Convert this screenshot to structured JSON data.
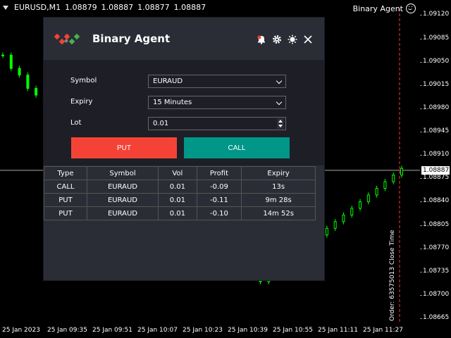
{
  "topbar": {
    "symbol": "EURUSD,M1",
    "prices": [
      "1.08879",
      "1.08887",
      "1.08877",
      "1.08887"
    ],
    "ea_name": "Binary Agent"
  },
  "chart_data": {
    "type": "line",
    "title": "",
    "xlabel": "",
    "ylabel": "",
    "x": [
      "25 Jan 2023",
      "25 Jan 09:35",
      "25 Jan 09:51",
      "25 Jan 10:07",
      "25 Jan 10:23",
      "25 Jan 10:39",
      "25 Jan 10:55",
      "25 Jan 11:11",
      "25 Jan 11:27"
    ],
    "ylim": [
      1.08665,
      1.0913
    ],
    "price_ticks": [
      "1.09120",
      "1.09085",
      "1.09050",
      "1.09015",
      "1.08980",
      "1.08945",
      "1.08910",
      "1.08875",
      "1.08840",
      "1.08805",
      "1.08770",
      "1.08735",
      "1.08700",
      "1.08665"
    ],
    "current_price": "1.08887",
    "current_price_value": 1.08887,
    "close_marker_label": "Order: 63575013 Close Time",
    "series": [
      {
        "values": [
          1.0906,
          1.0904,
          1.0903,
          1.0901,
          1.09,
          1.0899,
          1.0898,
          1.0897,
          1.0896,
          1.0895,
          1.0897,
          1.0896,
          1.0894,
          1.0893,
          1.0892,
          1.089,
          1.0889,
          1.0887,
          1.0885,
          1.0884,
          1.0883,
          1.0882,
          1.0881,
          1.088,
          1.0879,
          1.0878,
          1.0877,
          1.0876,
          1.0875,
          1.0874,
          1.0873,
          1.0872,
          1.0873,
          1.0874,
          1.0875,
          1.0876,
          1.0877,
          1.0878,
          1.0879,
          1.088,
          1.0881,
          1.0882,
          1.0883,
          1.0884,
          1.0885,
          1.0886,
          1.0887,
          1.0888,
          1.0889
        ]
      }
    ]
  },
  "panel": {
    "title": "Binary Agent",
    "form": {
      "symbol_label": "Symbol",
      "symbol_value": "EURAUD",
      "expiry_label": "Expiry",
      "expiry_value": "15 Minutes",
      "lot_label": "Lot",
      "lot_value": "0.01"
    },
    "put_label": "PUT",
    "call_label": "CALL",
    "table": {
      "headers": [
        "Type",
        "Symbol",
        "Vol",
        "Profit",
        "Expiry"
      ],
      "rows": [
        [
          "CALL",
          "EURAUD",
          "0.01",
          "-0.09",
          "13s"
        ],
        [
          "PUT",
          "EURAUD",
          "0.01",
          "-0.11",
          "9m 28s"
        ],
        [
          "PUT",
          "EURAUD",
          "0.01",
          "-0.10",
          "14m 52s"
        ]
      ]
    }
  },
  "colors": {
    "bull": "#00ff00",
    "put": "#f44336",
    "call": "#009688",
    "marker": "#ff3333"
  },
  "icons": [
    "notification-icon",
    "gear-icon",
    "sun-icon",
    "close-icon"
  ]
}
